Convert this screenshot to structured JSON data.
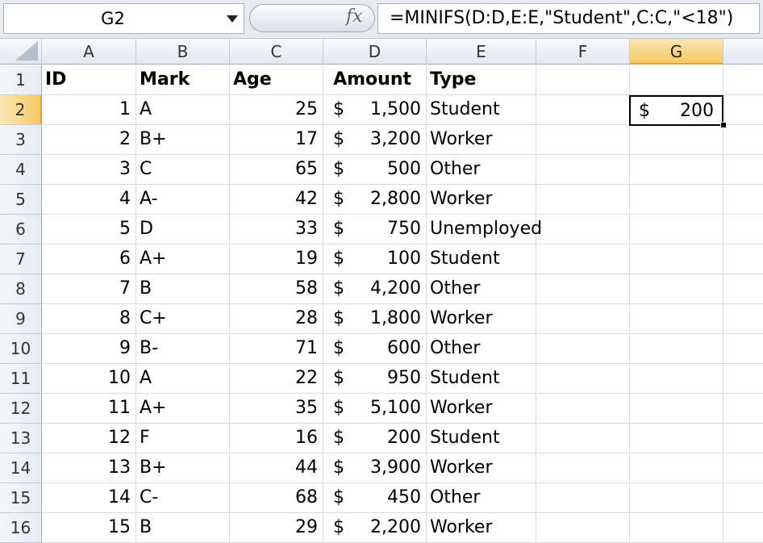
{
  "formula_bar": {
    "name_box": "G2",
    "fx_label": "fx",
    "formula": "=MINIFS(D:D,E:E,\"Student\",C:C,\"<18\")"
  },
  "columns": [
    "A",
    "B",
    "C",
    "D",
    "E",
    "F",
    "G"
  ],
  "selected_column": "G",
  "selected_row": "2",
  "header_row": {
    "row": "1",
    "id": "ID",
    "mark": "Mark",
    "age": "Age",
    "amount": "Amount",
    "type": "Type"
  },
  "rows": [
    {
      "row": "2",
      "id": "1",
      "mark": "A",
      "age": "25",
      "currency": "$",
      "amount": "1,500",
      "type": "Student"
    },
    {
      "row": "3",
      "id": "2",
      "mark": "B+",
      "age": "17",
      "currency": "$",
      "amount": "3,200",
      "type": "Worker"
    },
    {
      "row": "4",
      "id": "3",
      "mark": "C",
      "age": "65",
      "currency": "$",
      "amount": "500",
      "type": "Other"
    },
    {
      "row": "5",
      "id": "4",
      "mark": "A-",
      "age": "42",
      "currency": "$",
      "amount": "2,800",
      "type": "Worker"
    },
    {
      "row": "6",
      "id": "5",
      "mark": "D",
      "age": "33",
      "currency": "$",
      "amount": "750",
      "type": "Unemployed"
    },
    {
      "row": "7",
      "id": "6",
      "mark": "A+",
      "age": "19",
      "currency": "$",
      "amount": "100",
      "type": "Student"
    },
    {
      "row": "8",
      "id": "7",
      "mark": "B",
      "age": "58",
      "currency": "$",
      "amount": "4,200",
      "type": "Other"
    },
    {
      "row": "9",
      "id": "8",
      "mark": "C+",
      "age": "28",
      "currency": "$",
      "amount": "1,800",
      "type": "Worker"
    },
    {
      "row": "10",
      "id": "9",
      "mark": "B-",
      "age": "71",
      "currency": "$",
      "amount": "600",
      "type": "Other"
    },
    {
      "row": "11",
      "id": "10",
      "mark": "A",
      "age": "22",
      "currency": "$",
      "amount": "950",
      "type": "Student"
    },
    {
      "row": "12",
      "id": "11",
      "mark": "A+",
      "age": "35",
      "currency": "$",
      "amount": "5,100",
      "type": "Worker"
    },
    {
      "row": "13",
      "id": "12",
      "mark": "F",
      "age": "16",
      "currency": "$",
      "amount": "200",
      "type": "Student"
    },
    {
      "row": "14",
      "id": "13",
      "mark": "B+",
      "age": "44",
      "currency": "$",
      "amount": "3,900",
      "type": "Worker"
    },
    {
      "row": "15",
      "id": "14",
      "mark": "C-",
      "age": "68",
      "currency": "$",
      "amount": "450",
      "type": "Other"
    },
    {
      "row": "16",
      "id": "15",
      "mark": "B",
      "age": "29",
      "currency": "$",
      "amount": "2,200",
      "type": "Worker"
    }
  ],
  "result_cell": {
    "currency": "$",
    "value": "200"
  }
}
